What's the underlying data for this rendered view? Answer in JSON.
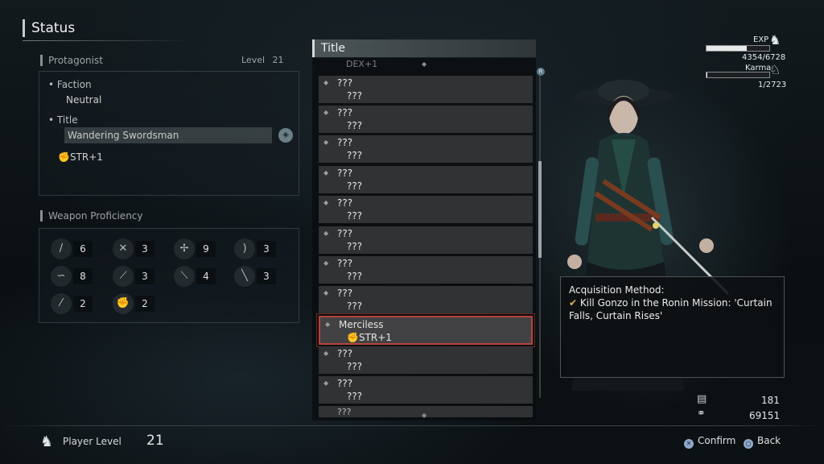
{
  "header": {
    "title": "Status"
  },
  "protagonist": {
    "label": "Protagonist",
    "level_label": "Level",
    "level": "21",
    "faction_label": "Faction",
    "faction_value": "Neutral",
    "title_label": "Title",
    "title_value": "Wandering Swordsman",
    "bonus": "STR+1"
  },
  "weapon_proficiency": {
    "label": "Weapon Proficiency",
    "items": [
      {
        "icon": "sword-icon",
        "value": "6"
      },
      {
        "icon": "dual-swords-icon",
        "value": "3"
      },
      {
        "icon": "spear-icon",
        "value": "9"
      },
      {
        "icon": "odachi-icon",
        "value": "3"
      },
      {
        "icon": "kusarigama-icon",
        "value": "8"
      },
      {
        "icon": "switchglaive-icon",
        "value": "3"
      },
      {
        "icon": "bow-icon",
        "value": "4"
      },
      {
        "icon": "katana-icon",
        "value": "3"
      },
      {
        "icon": "axe-icon",
        "value": "2"
      },
      {
        "icon": "fist-icon",
        "value": "2"
      }
    ]
  },
  "title_list": {
    "header": "Title",
    "top_partial": "DEX+1",
    "items": [
      {
        "name": "???",
        "sub": "???"
      },
      {
        "name": "???",
        "sub": "???"
      },
      {
        "name": "???",
        "sub": "???"
      },
      {
        "name": "???",
        "sub": "???"
      },
      {
        "name": "???",
        "sub": "???"
      },
      {
        "name": "???",
        "sub": "???"
      },
      {
        "name": "???",
        "sub": "???"
      },
      {
        "name": "???",
        "sub": "???"
      },
      {
        "name": "Merciless",
        "sub": "STR+1"
      },
      {
        "name": "???",
        "sub": "???"
      },
      {
        "name": "???",
        "sub": "???"
      }
    ],
    "bottom_partial": "???",
    "selected_index": 8
  },
  "stats": {
    "exp_label": "EXP",
    "exp_value": "4354/6728",
    "exp_fraction": 0.647,
    "karma_label": "Karma",
    "karma_value": "1/2723",
    "karma_fraction": 0.0004
  },
  "acquisition": {
    "label": "Acquisition Method:",
    "text": "Kill Gonzo in the Ronin Mission: 'Curtain Falls, Curtain Rises'"
  },
  "currencies": {
    "amrita_scrolls": "181",
    "gold": "69151"
  },
  "footer": {
    "player_level_label": "Player Level",
    "player_level": "21",
    "confirm_label": "Confirm",
    "back_label": "Back"
  },
  "colors": {
    "selected_border": "#b8443a",
    "check": "#e2b64a"
  }
}
